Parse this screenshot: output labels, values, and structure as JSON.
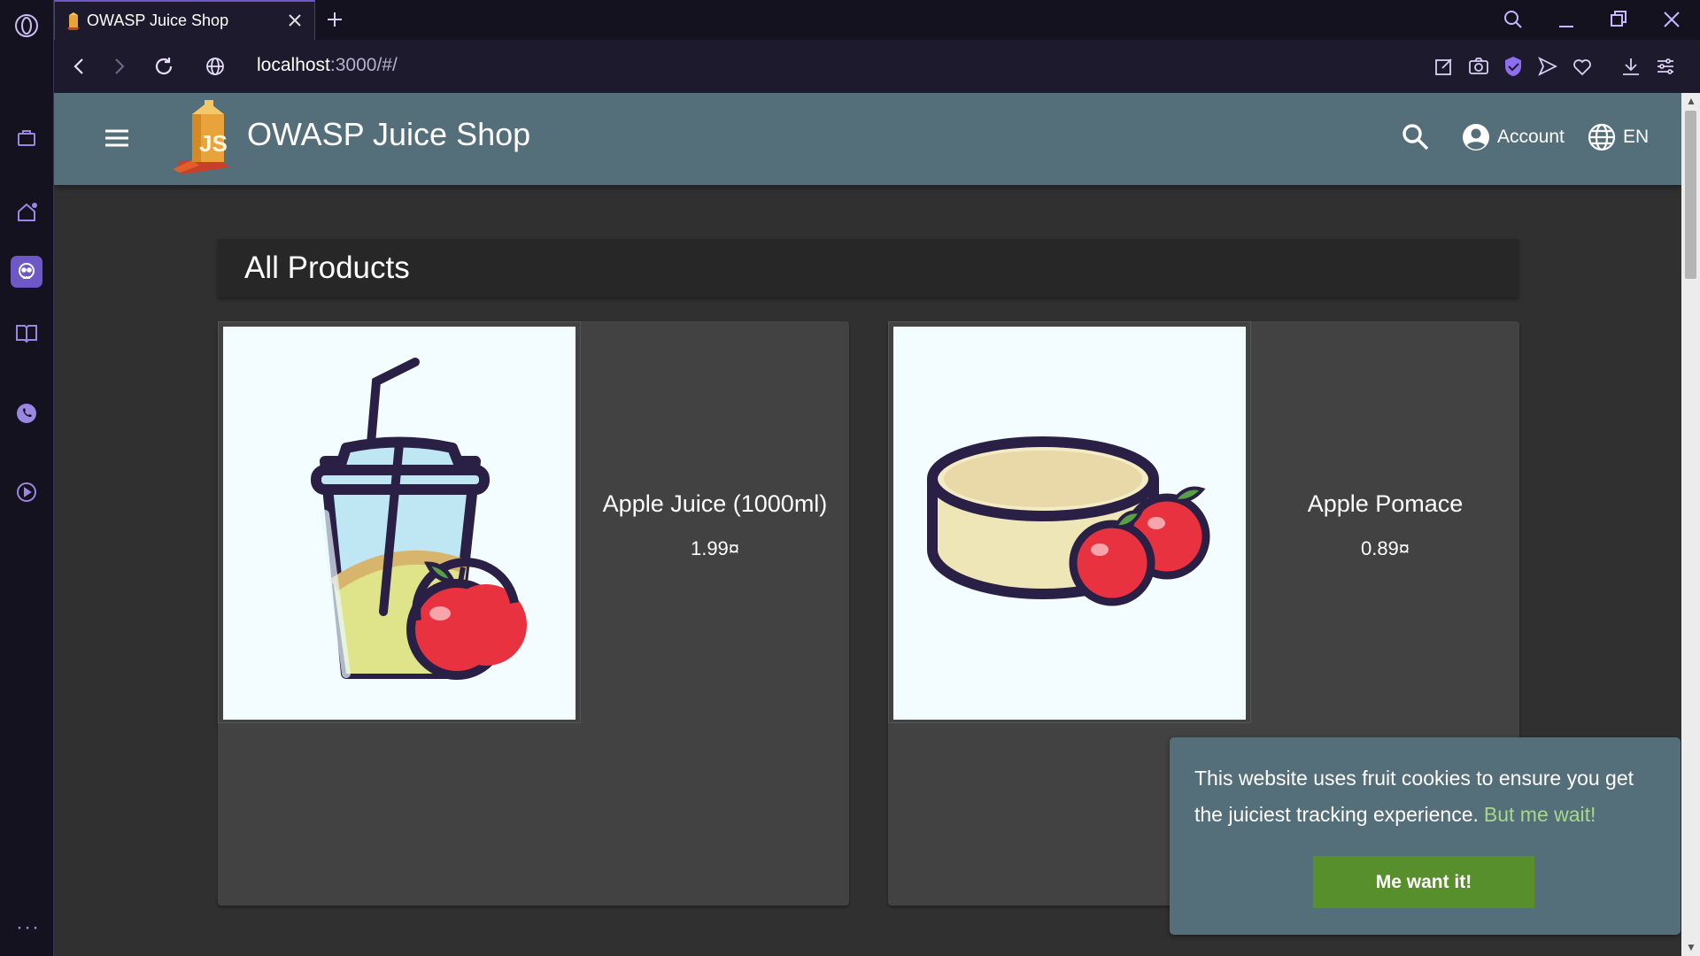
{
  "browser": {
    "tab_title": "OWASP Juice Shop",
    "url_host": "localhost",
    "url_rest": ":3000/#/"
  },
  "header": {
    "title": "OWASP Juice Shop",
    "account_label": "Account",
    "language_label": "EN"
  },
  "main": {
    "heading": "All Products",
    "products": [
      {
        "name": "Apple Juice (1000ml)",
        "price": "1.99¤"
      },
      {
        "name": "Apple Pomace",
        "price": "0.89¤"
      }
    ]
  },
  "cookie_banner": {
    "message": "This website uses fruit cookies to ensure you get the juiciest tracking experience.",
    "learn_more": "But me wait!",
    "accept": "Me want it!"
  },
  "colors": {
    "toolbar": "#546e7a",
    "page_bg": "#303030",
    "card_bg": "#424242",
    "accept_button": "#578f2c",
    "link": "#a8d88a",
    "opera_accent": "#6e57c7"
  },
  "icons": {
    "sidebar": [
      "opera-logo-icon",
      "bag-icon",
      "home-icon",
      "aria-icon",
      "bookmark-book-icon",
      "whatsapp-icon",
      "player-icon",
      "more-icon"
    ],
    "toolbar": [
      "snapshot-edit-icon",
      "camera-icon",
      "shield-icon",
      "send-icon",
      "heart-icon",
      "download-icon",
      "easy-setup-icon"
    ]
  }
}
